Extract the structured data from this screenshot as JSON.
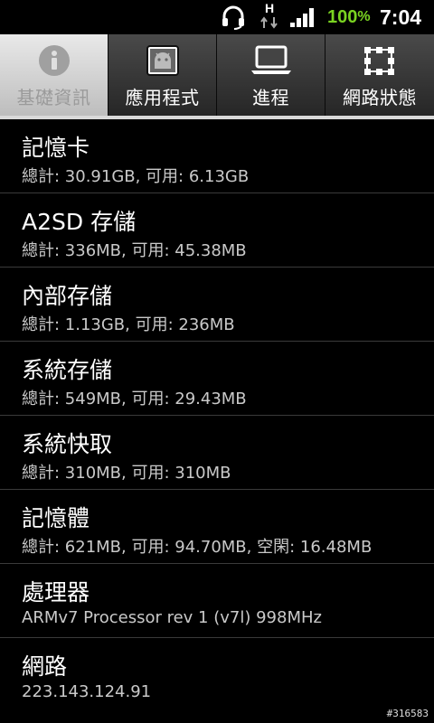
{
  "status_bar": {
    "network_type": "H",
    "battery_value": "100",
    "battery_unit": "%",
    "time": "7:04",
    "battery_color": "#7ad321"
  },
  "tabs": [
    {
      "label": "基礎資訊",
      "icon": "info-icon",
      "active": true
    },
    {
      "label": "應用程式",
      "icon": "android-app-icon",
      "active": false
    },
    {
      "label": "進程",
      "icon": "monitor-icon",
      "active": false
    },
    {
      "label": "網路狀態",
      "icon": "network-grid-icon",
      "active": false
    }
  ],
  "items": [
    {
      "title": "記憶卡",
      "detail": "總計: 30.91GB, 可用: 6.13GB"
    },
    {
      "title": "A2SD 存儲",
      "detail": "總計: 336MB, 可用: 45.38MB"
    },
    {
      "title": "內部存儲",
      "detail": "總計: 1.13GB, 可用: 236MB"
    },
    {
      "title": "系統存儲",
      "detail": "總計: 549MB, 可用: 29.43MB"
    },
    {
      "title": "系統快取",
      "detail": "總計: 310MB, 可用: 310MB"
    },
    {
      "title": "記憶體",
      "detail": "總計: 621MB, 可用: 94.70MB, 空閑: 16.48MB"
    },
    {
      "title": "處理器",
      "detail": "ARMv7 Processor rev 1 (v7l)  998MHz"
    },
    {
      "title": "網路",
      "detail": "223.143.124.91"
    }
  ],
  "watermark": "#316583"
}
